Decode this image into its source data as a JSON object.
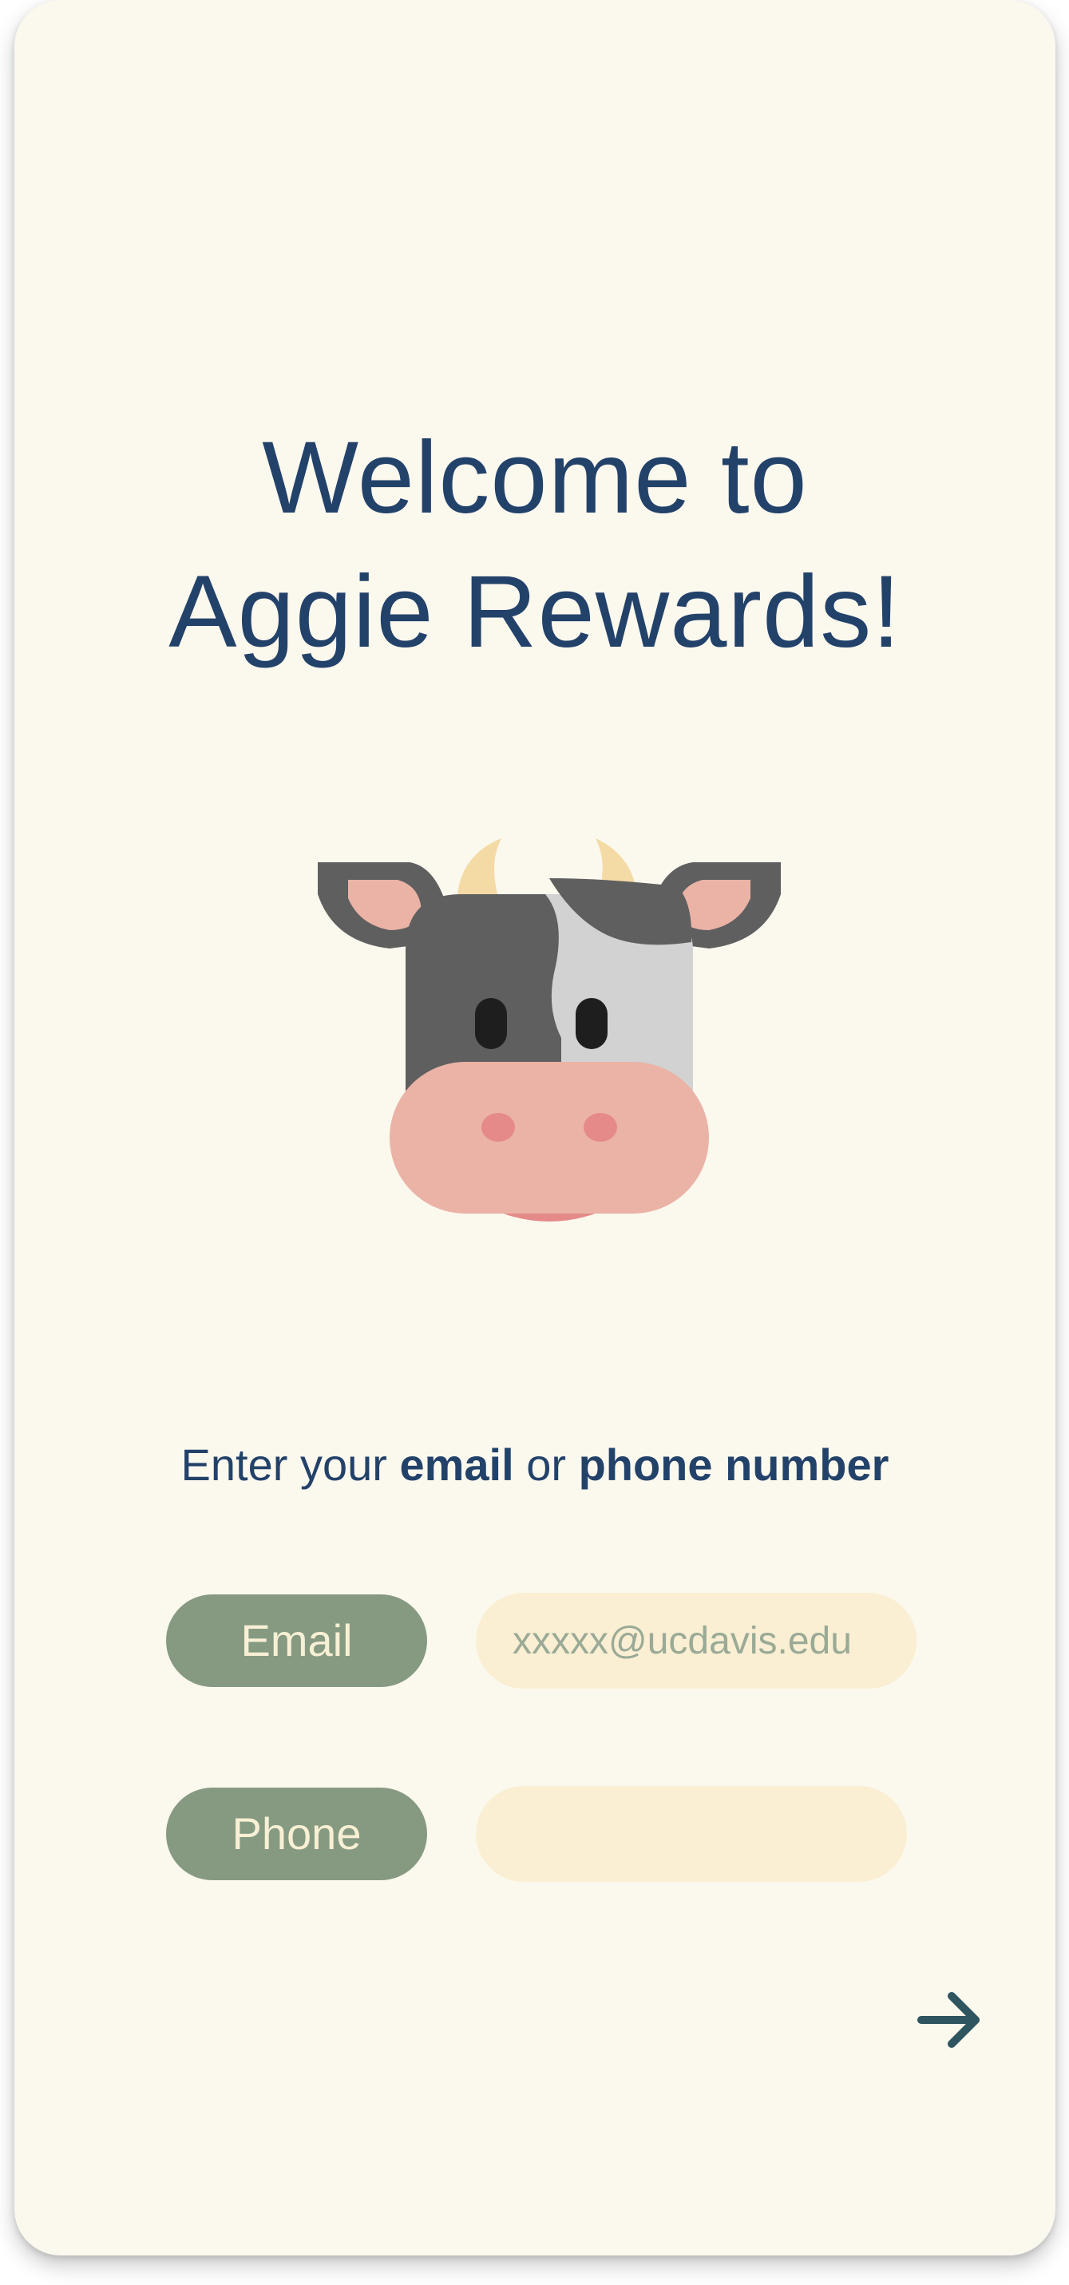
{
  "title": {
    "line1": "Welcome to",
    "line2": "Aggie Rewards!"
  },
  "mascot": {
    "icon": "cow-face-icon"
  },
  "prompt": {
    "text_before": "Enter your ",
    "email_word": "email",
    "text_middle": " or ",
    "phone_word": "phone number"
  },
  "form": {
    "email_label": "Email",
    "email_placeholder": "xxxxx@ucdavis.edu",
    "email_value": "",
    "phone_label": "Phone",
    "phone_placeholder": "",
    "phone_value": ""
  },
  "next_button": {
    "icon": "arrow-right-icon"
  },
  "colors": {
    "background": "#fbf8ee",
    "title": "#23426a",
    "label_pill": "#869a82",
    "label_text": "#f8f0d4",
    "input_pill": "#faefd3",
    "arrow": "#2f5560"
  }
}
